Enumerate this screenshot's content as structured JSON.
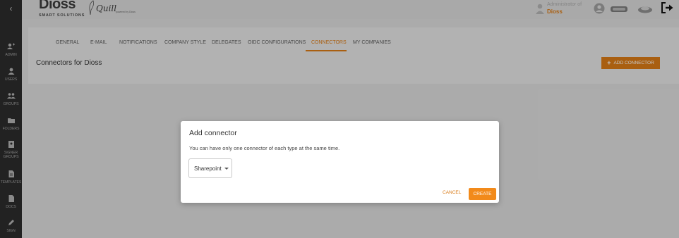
{
  "sidebar": {
    "back_icon": "‹",
    "items": [
      {
        "label": "ADMIN",
        "icon": "admin-icon"
      },
      {
        "label": "USERS",
        "icon": "user-icon"
      },
      {
        "label": "GROUPS",
        "icon": "groups-icon"
      },
      {
        "label": "FOLDERS",
        "icon": "folder-icon"
      },
      {
        "label": "SIGNER",
        "label2": "GROUPS",
        "icon": "signer-groups-icon"
      },
      {
        "label": "TEMPLATES",
        "icon": "template-icon"
      },
      {
        "label": "DOCS",
        "icon": "document-icon"
      },
      {
        "label": "SIGN",
        "icon": "pen-icon"
      }
    ]
  },
  "header": {
    "logo": "Dioss",
    "logo_sub": "SMART SOLUTIONS",
    "quill": "Quill",
    "quill_sub": "powered by Dioss",
    "user_role": "Administrator of",
    "user_company": "Dioss"
  },
  "tabs": [
    {
      "label": "GENERAL",
      "active": false
    },
    {
      "label": "E-MAIL",
      "active": false
    },
    {
      "label": "NOTIFICATIONS",
      "active": false
    },
    {
      "label": "COMPANY STYLE",
      "active": false
    },
    {
      "label": "DELEGATES",
      "active": false
    },
    {
      "label": "OIDC CONFIGURATIONS",
      "active": false
    },
    {
      "label": "CONNECTORS",
      "active": true
    },
    {
      "label": "MY COMPANIES",
      "active": false
    }
  ],
  "main": {
    "title": "Connectors for Dioss",
    "add_button": "ADD CONNECTOR"
  },
  "dialog": {
    "title": "Add connector",
    "description": "You can have only one connector of each type at the same time.",
    "select_value": "Sharepoint",
    "cancel": "CANCEL",
    "create": "CREATE"
  },
  "colors": {
    "accent": "#d97a16",
    "sidebar": "#222222"
  }
}
